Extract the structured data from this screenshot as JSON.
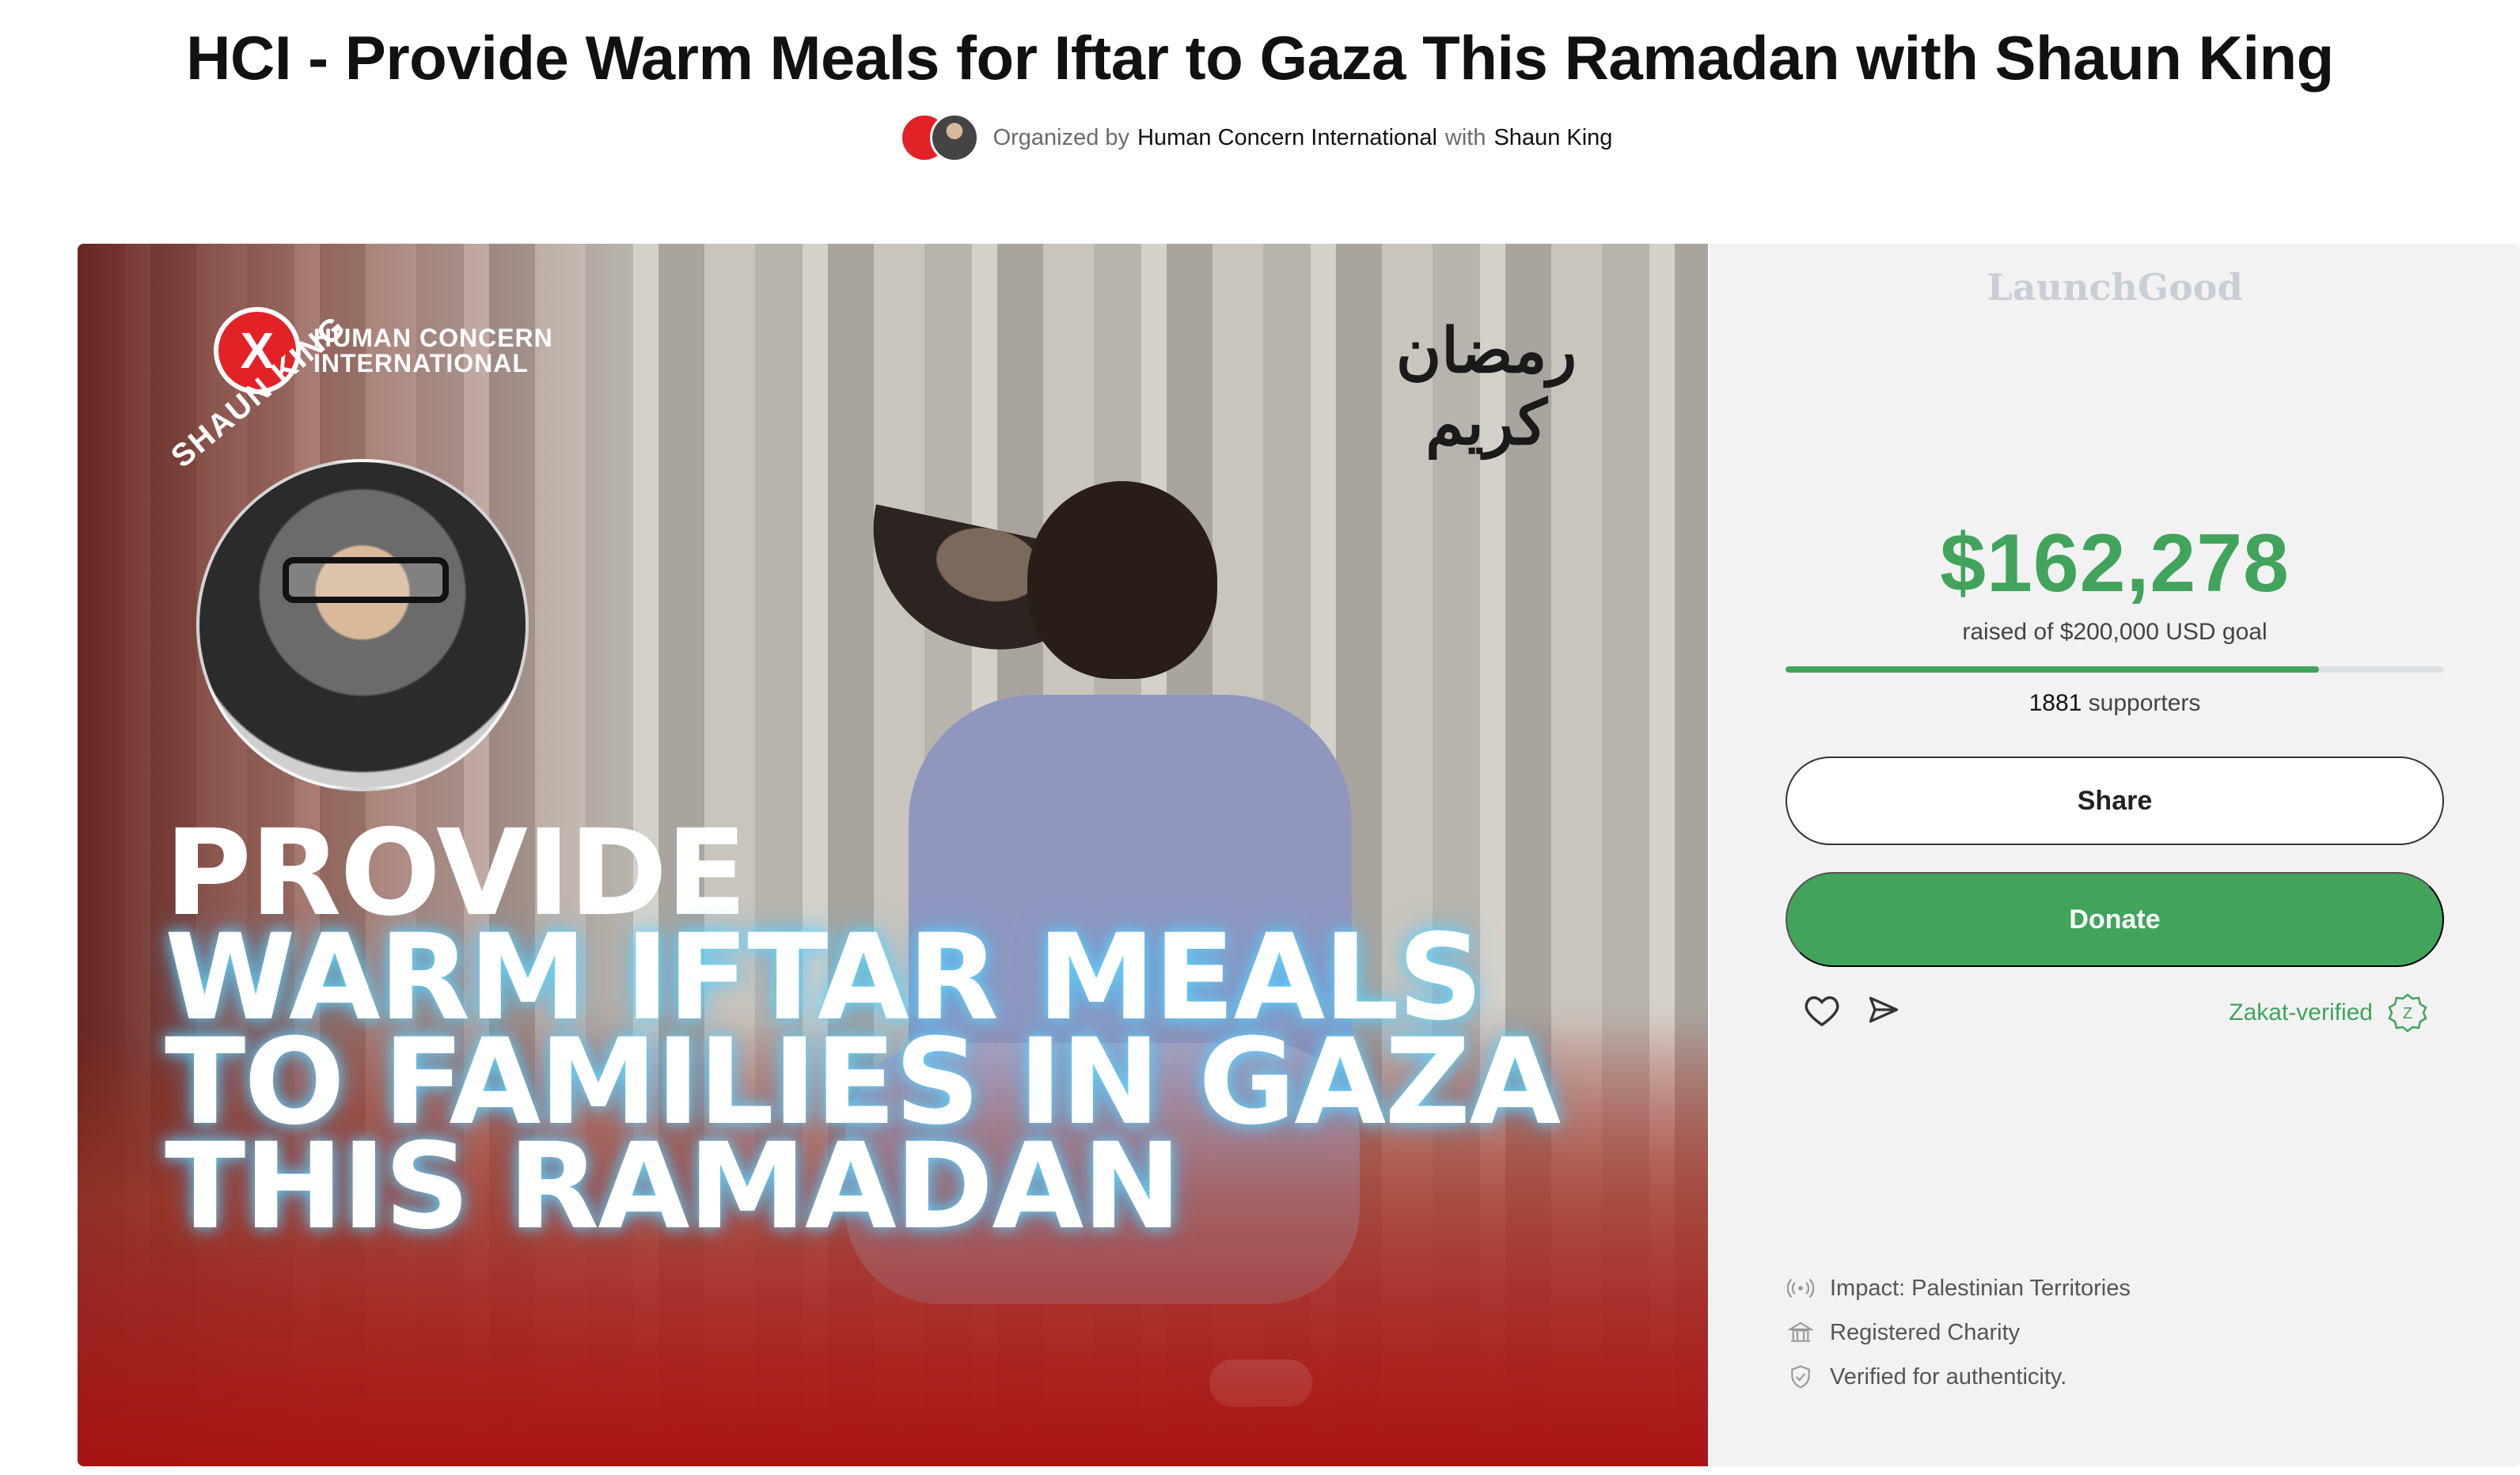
{
  "title": "HCI - Provide Warm Meals for Iftar to Gaza This Ramadan with Shaun King",
  "organizer": {
    "prefix": "Organized by",
    "org_name": "Human Concern International",
    "with": "with",
    "co_name": "Shaun King"
  },
  "hero": {
    "logo_mark": "X",
    "logo_line1": "HUMAN CONCERN",
    "logo_line2": "INTERNATIONAL",
    "arabic_greeting": "رمضان كريم",
    "celebrity_label": "SHAUN KING",
    "headline": [
      "PROVIDE",
      "WARM IFTAR MEALS",
      "TO FAMILIES IN GAZA",
      "THIS RAMADAN"
    ]
  },
  "panel": {
    "brand": "LaunchGood",
    "amount": "$162,278",
    "goal_text": "raised of $200,000 USD goal",
    "progress": 0.81,
    "supporters_count": "1881",
    "supporters_label": "supporters",
    "share_label": "Share",
    "donate_label": "Donate",
    "zakat_label": "Zakat-verified",
    "zakat_badge": "Z",
    "facts": [
      {
        "icon": "broadcast-icon",
        "text": "Impact: Palestinian Territories"
      },
      {
        "icon": "bank-icon",
        "text": "Registered Charity"
      },
      {
        "icon": "shield-check-icon",
        "text": "Verified for authenticity."
      }
    ]
  },
  "colors": {
    "accent_green": "#41a35c",
    "hci_red": "#e32228",
    "text_dark": "#111111",
    "panel_bg": "#f2f2f2"
  }
}
